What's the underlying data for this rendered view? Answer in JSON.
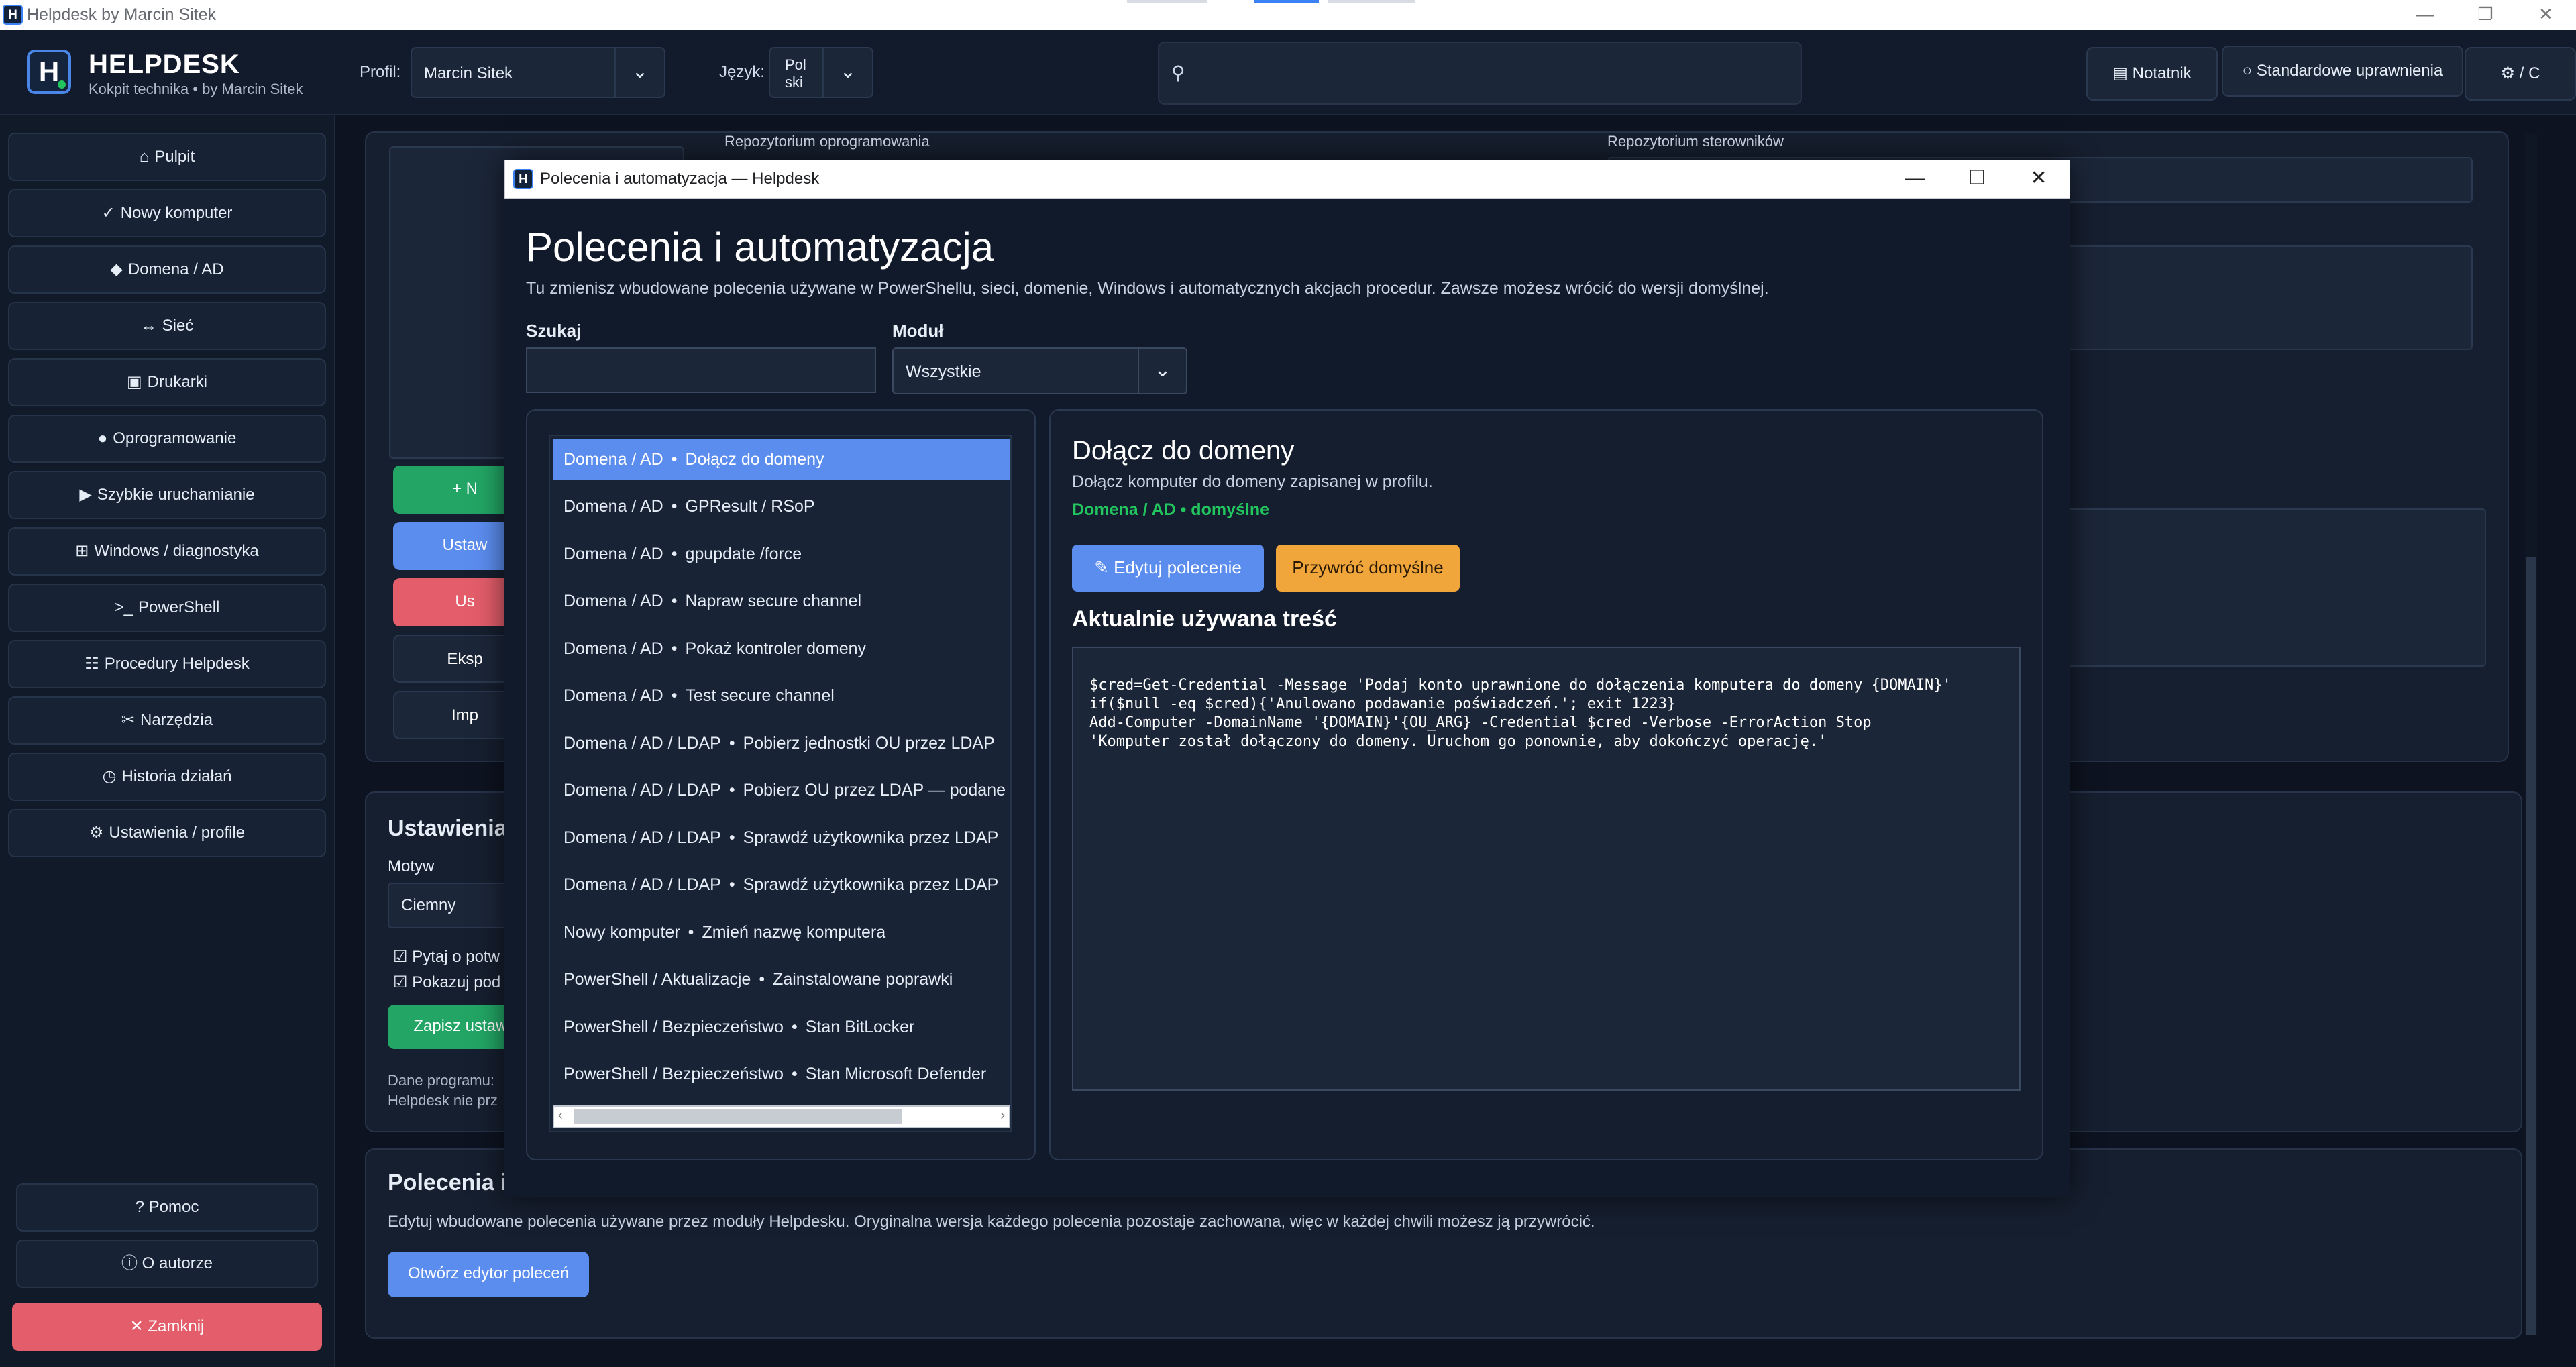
{
  "os_window": {
    "title": "Helpdesk by Marcin Sitek",
    "min": "—",
    "max": "❐",
    "close": "✕",
    "icon_letter": "H"
  },
  "header": {
    "brand": "HELPDESK",
    "subtitle": "Kokpit technika • by Marcin Sitek",
    "profile_label": "Profil:",
    "profile_value": "Marcin Sitek",
    "language_label": "Język:",
    "language_value_line1": "Pol",
    "language_value_line2": "ski",
    "search_icon": "search-icon",
    "notebook_label": "Notatnik",
    "permissions_label": "Standardowe uprawnienia",
    "theme_label": "/ C"
  },
  "sidebar": {
    "items": [
      {
        "icon": "⌂",
        "label": "Pulpit"
      },
      {
        "icon": "✓",
        "label": "Nowy komputer"
      },
      {
        "icon": "◆",
        "label": "Domena / AD"
      },
      {
        "icon": "↔",
        "label": "Sieć"
      },
      {
        "icon": "▣",
        "label": "Drukarki"
      },
      {
        "icon": "●",
        "label": "Oprogramowanie"
      },
      {
        "icon": "▶",
        "label": "Szybkie uruchamianie"
      },
      {
        "icon": "⊞",
        "label": "Windows / diagnostyka"
      },
      {
        "icon": ">_",
        "label": "PowerShell"
      },
      {
        "icon": "☷",
        "label": "Procedury Helpdesk"
      },
      {
        "icon": "✂",
        "label": "Narzędzia"
      },
      {
        "icon": "◷",
        "label": "Historia działań"
      },
      {
        "icon": "⚙",
        "label": "Ustawienia / profile"
      }
    ],
    "help": {
      "icon": "?",
      "label": "Pomoc"
    },
    "about": {
      "icon": "ⓘ",
      "label": "O autorze"
    },
    "close": {
      "icon": "✕",
      "label": "Zamknij"
    }
  },
  "background": {
    "repo_software": "Repozytorium oprogramowania",
    "repo_drivers": "Repozytorium sterowników",
    "btn_new": "+ N",
    "btn_set": "Ustaw",
    "btn_remove": "Us",
    "btn_export": "Eksp",
    "btn_import": "Imp",
    "settings_title": "Ustawienia",
    "theme_label": "Motyw",
    "theme_value": "Ciemny",
    "check1": "Pytaj o potw",
    "check2": "Pokazuj pod",
    "save_btn": "Zapisz ustawi",
    "data_line1": "Dane programu:",
    "data_line2": "Helpdesk nie prz",
    "commands_title": "Polecenia i",
    "commands_desc": "Edytuj wbudowane polecenia używane przez moduły Helpdesku. Oryginalna wersja każdego polecenia pozostaje zachowana, więc w każdej chwili możesz ją przywrócić.",
    "open_editor_btn": "Otwórz edytor poleceń"
  },
  "modal": {
    "window_title": "Polecenia i automatyzacja — Helpdesk",
    "title": "Polecenia i automatyzacja",
    "description": "Tu zmienisz wbudowane polecenia używane w PowerShellu, sieci, domenie, Windows i automatycznych akcjach procedur. Zawsze możesz wrócić do wersji domyślnej.",
    "search_label": "Szukaj",
    "search_value": "",
    "module_label": "Moduł",
    "module_value": "Wszystkie",
    "list": [
      {
        "module": "Domena / AD",
        "name": "Dołącz do domeny",
        "selected": true
      },
      {
        "module": "Domena / AD",
        "name": "GPResult / RSoP"
      },
      {
        "module": "Domena / AD",
        "name": "gpupdate /force"
      },
      {
        "module": "Domena / AD",
        "name": "Napraw secure channel"
      },
      {
        "module": "Domena / AD",
        "name": "Pokaż kontroler domeny"
      },
      {
        "module": "Domena / AD",
        "name": "Test secure channel"
      },
      {
        "module": "Domena / AD / LDAP",
        "name": "Pobierz jednostki OU przez LDAP"
      },
      {
        "module": "Domena / AD / LDAP",
        "name": "Pobierz OU przez LDAP — podane"
      },
      {
        "module": "Domena / AD / LDAP",
        "name": "Sprawdź użytkownika przez LDAP"
      },
      {
        "module": "Domena / AD / LDAP",
        "name": "Sprawdź użytkownika przez LDAP"
      },
      {
        "module": "Nowy komputer",
        "name": "Zmień nazwę komputera"
      },
      {
        "module": "PowerShell / Aktualizacje",
        "name": "Zainstalowane poprawki"
      },
      {
        "module": "PowerShell / Bezpieczeństwo",
        "name": "Stan BitLocker"
      },
      {
        "module": "PowerShell / Bezpieczeństwo",
        "name": "Stan Microsoft Defender"
      }
    ],
    "separator": "•",
    "detail": {
      "title": "Dołącz do domeny",
      "description": "Dołącz komputer do domeny zapisanej w profilu.",
      "meta": "Domena / AD • domyślne",
      "edit_btn": "Edytuj polecenie",
      "restore_btn": "Przywróć domyślne",
      "content_heading": "Aktualnie używana treść",
      "code": "$cred=Get-Credential -Message 'Podaj konto uprawnione do dołączenia komputera do domeny {DOMAIN}'\nif($null -eq $cred){'Anulowano podawanie poświadczeń.'; exit 1223}\nAdd-Computer -DomainName '{DOMAIN}'{OU_ARG} -Credential $cred -Verbose -ErrorAction Stop\n'Komputer został dołączony do domeny. Uruchom go ponownie, aby dokończyć operację.'"
    }
  },
  "colors": {
    "accent": "#5b8def",
    "green": "#22c55e",
    "red": "#e35d6a",
    "orange": "#f0a63a"
  }
}
